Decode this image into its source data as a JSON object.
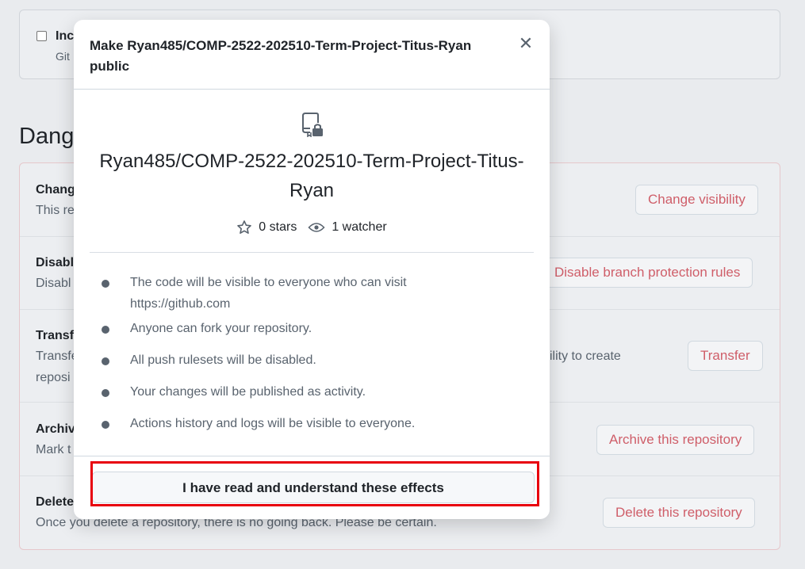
{
  "background": {
    "checkbox_label": "Inc",
    "checkbox_sub": "Git",
    "danger_title": "Dang",
    "rows": [
      {
        "title": "Chang",
        "desc": "This re",
        "button": "Change visibility"
      },
      {
        "title": "Disabl",
        "desc": "Disabl",
        "button": "Disable branch protection rules"
      },
      {
        "title": "Transf",
        "desc": "Transfe",
        "desc2": "reposi",
        "desc_right": "ility to create",
        "button": "Transfer"
      },
      {
        "title": "Archiv",
        "desc": "Mark t",
        "button": "Archive this repository"
      },
      {
        "title": "Delete",
        "desc": "Once you delete a repository, there is no going back. Please be certain.",
        "button": "Delete this repository"
      }
    ]
  },
  "modal": {
    "title": "Make Ryan485/COMP-2522-202510-Term-Project-Titus-Ryan public",
    "close_icon": "close-icon",
    "repo_icon": "repo-locked-icon",
    "repo_name": "Ryan485/COMP-2522-202510-Term-Project-Titus-Ryan",
    "stars": "0 stars",
    "watchers": "1 watcher",
    "effects": [
      "The code will be visible to everyone who can visit https://github.com",
      "Anyone can fork your repository.",
      "All push rulesets will be disabled.",
      "Your changes will be published as activity.",
      "Actions history and logs will be visible to everyone."
    ],
    "confirm_button": "I have read and understand these effects"
  },
  "colors": {
    "danger_text": "#cf5e69",
    "highlight": "#e8000d",
    "backdrop": "#e9ebee"
  }
}
